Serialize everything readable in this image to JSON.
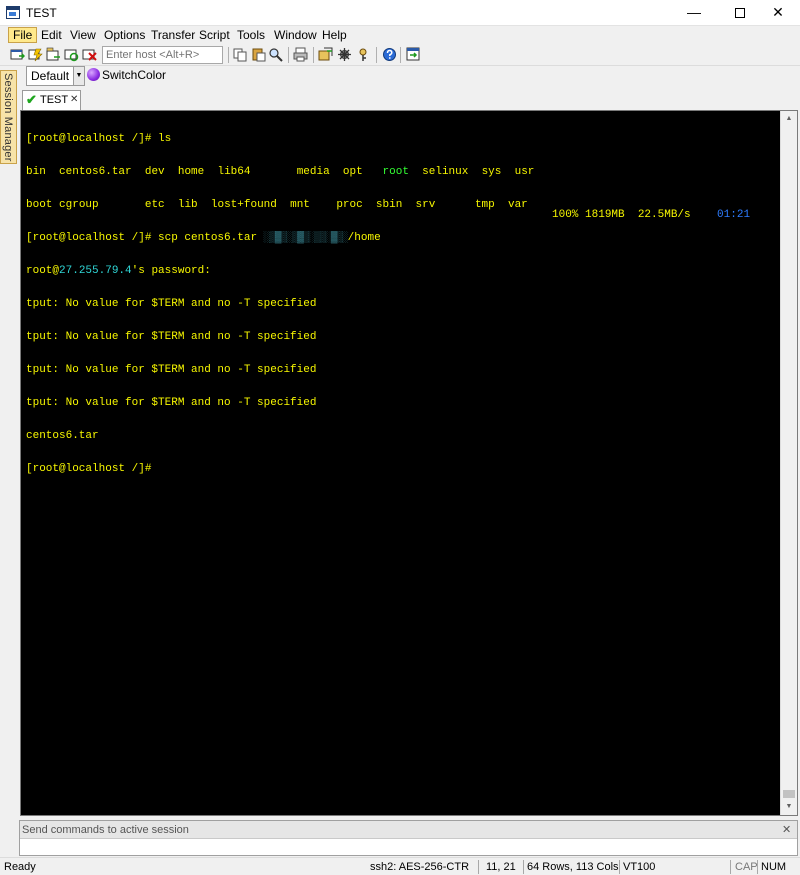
{
  "window": {
    "title": "TEST",
    "controls": {
      "minimize": "—",
      "close": "✕"
    }
  },
  "menu": [
    "File",
    "Edit",
    "View",
    "Options",
    "Transfer",
    "Script",
    "Tools",
    "Window",
    "Help"
  ],
  "toolbar": {
    "host_placeholder": "Enter host <Alt+R>"
  },
  "button_bar": {
    "selected": "Default",
    "switch_color_label": "SwitchColor"
  },
  "session_manager": {
    "label": "Session Manager"
  },
  "tab": {
    "label": "TEST",
    "close": "✕"
  },
  "terminal": {
    "prompt": "[root@localhost /]#",
    "cmd_ls": " ls",
    "ls_row1": [
      "bin",
      "centos6.tar",
      "dev",
      "home",
      "lib64",
      "media",
      "opt",
      "root",
      "selinux",
      "sys",
      "usr"
    ],
    "ls_row2": [
      "boot",
      "cgroup",
      "etc",
      "lib",
      "lost+found",
      "mnt",
      "proc",
      "sbin",
      "srv",
      "tmp",
      "var"
    ],
    "cmd_scp": " scp centos6.tar ",
    "scp_dest": "/home",
    "password_user": "root@",
    "password_host": "27.255.79.4",
    "password_suffix": "'s password:",
    "tput_warning": "tput: No value for $TERM and no -T specified",
    "transfer_file": "centos6.tar",
    "transfer_percent": "100%",
    "transfer_size": "1819MB",
    "transfer_rate": "22.5MB/s",
    "transfer_time": "01:21"
  },
  "command_window": {
    "placeholder": "Send commands to active session",
    "close": "✕"
  },
  "status": {
    "ready": "Ready",
    "cipher": "ssh2: AES-256-CTR",
    "cursor": "11, 21",
    "size": "64 Rows, 113 Cols",
    "emulation": "VT100",
    "cap": "CAP",
    "num": "NUM"
  },
  "colors": {
    "terminal_bg": "#000000",
    "prompt_yellow": "#f7f700",
    "dir_green": "#33ff33",
    "host_teal": "#2fd6d6",
    "time_blue": "#2d7cff",
    "active_menu_bg": "#ffe98c"
  }
}
